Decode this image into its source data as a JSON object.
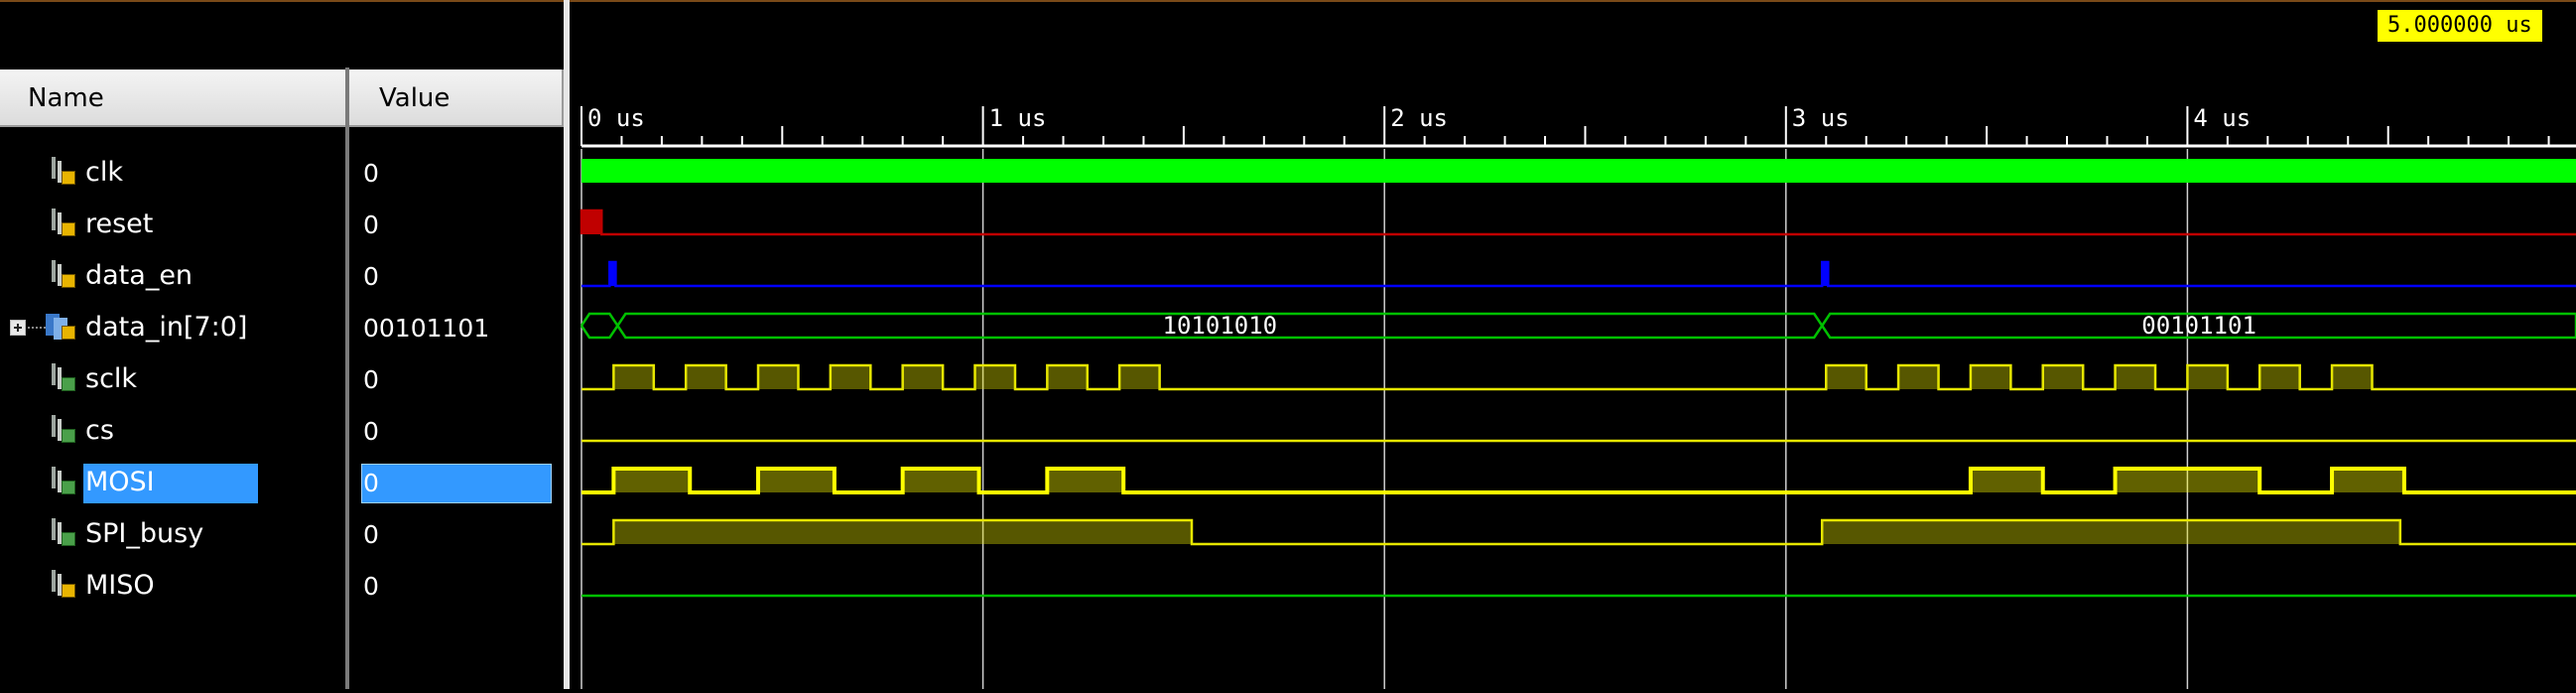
{
  "columns": {
    "name": "Name",
    "value": "Value"
  },
  "cursor_time": "5.000000 us",
  "timeline": {
    "unit": "us",
    "range_us": [
      0,
      5.0
    ],
    "major_ticks": [
      {
        "t": 0,
        "label": "0 us"
      },
      {
        "t": 1,
        "label": "1 us"
      },
      {
        "t": 2,
        "label": "2 us"
      },
      {
        "t": 3,
        "label": "3 us"
      },
      {
        "t": 4,
        "label": "4 us"
      }
    ]
  },
  "signals": [
    {
      "name": "clk",
      "value": "0",
      "kind": "bit",
      "icon": "signal-icon",
      "color": "#00ff00",
      "fast_clock": true
    },
    {
      "name": "reset",
      "value": "0",
      "kind": "bit",
      "icon": "signal-icon",
      "color": "#c00000",
      "highs": [
        [
          0.0,
          0.05
        ]
      ]
    },
    {
      "name": "data_en",
      "value": "0",
      "kind": "bit",
      "icon": "signal-icon",
      "color": "#0000ff",
      "highs": [
        [
          0.07,
          0.085
        ],
        [
          3.09,
          3.105
        ]
      ]
    },
    {
      "name": "data_in[7:0]",
      "value": "00101101",
      "kind": "bus",
      "icon": "bus-icon",
      "color": "#00c000",
      "segments": [
        {
          "from": 0.0,
          "to": 0.09,
          "label": ""
        },
        {
          "from": 0.09,
          "to": 3.09,
          "label": "10101010"
        },
        {
          "from": 3.09,
          "to": 5.0,
          "label": "00101101"
        }
      ]
    },
    {
      "name": "sclk",
      "value": "0",
      "kind": "bit",
      "icon": "signal-icon",
      "color": "#e6e600",
      "highs": [
        [
          0.08,
          0.18
        ],
        [
          0.26,
          0.36
        ],
        [
          0.44,
          0.54
        ],
        [
          0.62,
          0.72
        ],
        [
          0.8,
          0.9
        ],
        [
          0.98,
          1.08
        ],
        [
          1.16,
          1.26
        ],
        [
          1.34,
          1.44
        ],
        [
          3.1,
          3.2
        ],
        [
          3.28,
          3.38
        ],
        [
          3.46,
          3.56
        ],
        [
          3.64,
          3.74
        ],
        [
          3.82,
          3.92
        ],
        [
          4.0,
          4.1
        ],
        [
          4.18,
          4.28
        ],
        [
          4.36,
          4.46
        ]
      ]
    },
    {
      "name": "cs",
      "value": "0",
      "kind": "bit",
      "icon": "signal-icon",
      "color": "#e6e600",
      "highs": []
    },
    {
      "name": "MOSI",
      "value": "0",
      "kind": "bit",
      "icon": "signal-icon",
      "color": "#ffff00",
      "selected": true,
      "highs": [
        [
          0.08,
          0.27
        ],
        [
          0.44,
          0.63
        ],
        [
          0.8,
          0.99
        ],
        [
          1.16,
          1.35
        ],
        [
          3.46,
          3.64
        ],
        [
          3.82,
          4.18
        ],
        [
          4.36,
          4.54
        ]
      ]
    },
    {
      "name": "SPI_busy",
      "value": "0",
      "kind": "bit",
      "icon": "signal-icon",
      "color": "#e6e600",
      "highs": [
        [
          0.08,
          1.52
        ],
        [
          3.09,
          4.53
        ]
      ]
    },
    {
      "name": "MISO",
      "value": "0",
      "kind": "bit",
      "icon": "signal-icon",
      "color": "#00c000",
      "highs": []
    }
  ]
}
